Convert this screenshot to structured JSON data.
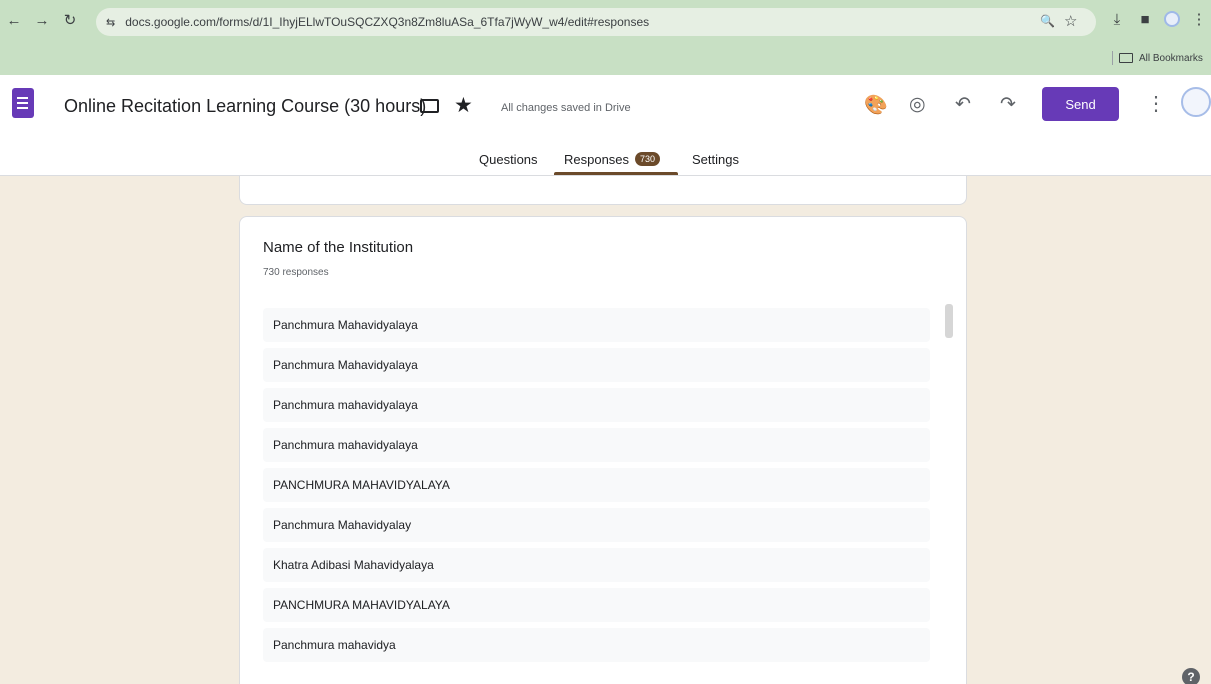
{
  "browser": {
    "url": "docs.google.com/forms/d/1I_IhyjELlwTOuSQCZXQ3n8Zm8luASa_6Tfa7jWyW_w4/edit#responses",
    "back_icon": "←",
    "forward_icon": "→",
    "reload_icon": "↻",
    "site_icon": "⇆",
    "zoom_icon": "🔍",
    "star_icon": "☆",
    "download_icon": "⤓",
    "sidepanel_icon": "■",
    "menu_icon": "⋮",
    "bookmarks_label": "All Bookmarks"
  },
  "header": {
    "title": "Online Recitation Learning Course (30 hours)",
    "saved_status": "All changes saved in Drive",
    "star_icon": "★",
    "palette_icon": "🎨",
    "preview_icon": "◎",
    "undo_icon": "↶",
    "redo_icon": "↷",
    "send_label": "Send",
    "more_icon": "⋮"
  },
  "tabs": {
    "questions": "Questions",
    "responses": "Responses",
    "responses_badge": "730",
    "settings": "Settings"
  },
  "question": {
    "title": "Name of the Institution",
    "count": "730 responses",
    "responses": [
      "Panchmura Mahavidyalaya",
      "Panchmura Mahavidyalaya",
      "Panchmura mahavidyalaya",
      "Panchmura mahavidyalaya",
      "PANCHMURA MAHAVIDYALAYA",
      "Panchmura Mahavidyalay",
      "Khatra Adibasi Mahavidyalaya",
      "PANCHMURA MAHAVIDYALAYA",
      "Panchmura mahavidya"
    ]
  },
  "help_icon": "?"
}
